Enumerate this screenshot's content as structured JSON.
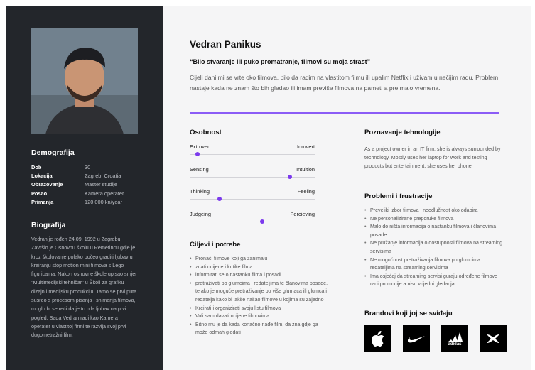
{
  "persona": {
    "name": "Vedran Panikus",
    "quote": "“Bilo stvaranje ili puko promatranje, filmovi su moja strast”",
    "intro": "Cijeli dani mi se vrte oko filmova, bilo da radim na vlastitom filmu ili upalim Netflix i uživam u nečijim radu. Problem nastaje kada ne znam što bih gledao ili imam previše filmova na pameti a pre malo vremena."
  },
  "demografija": {
    "title": "Demografija",
    "rows": [
      {
        "key": "Dob",
        "value": "30"
      },
      {
        "key": "Lokacija",
        "value": "Zagreb, Croatia"
      },
      {
        "key": "Obrazovanje",
        "value": "Master studije"
      },
      {
        "key": "Posao",
        "value": "Kamera operater"
      },
      {
        "key": "Primanja",
        "value": "120,000 kn/year"
      }
    ]
  },
  "biografija": {
    "title": "Biografija",
    "text": "Vedran je rođen 24.09. 1992 u Zagrebu. Završio je Osnovnu školu u Remetincu gdje je kroz školovanje polako počeo graditi ljubav u kreiranju stop motion mini filmova s Lego figuricama. Nakon osnovne škole upisao smjer \"Multimedijski tehničar\" u Školi za grafiku dizajn i medijsku produkciju. Tamo se prvi puta susreo s procesom pisanja i snimanja filmova, moglo bi se reći da je to bila ljubav na prvi pogled. Sada Vedran radi kao Kamera operater u vlastitoj firmi te razvija svoj prvi dugometražni film."
  },
  "osobnost": {
    "title": "Osobnost",
    "sliders": [
      {
        "left": "Extrovert",
        "right": "Inrovert",
        "value": 0.06
      },
      {
        "left": "Sensing",
        "right": "Intuition",
        "value": 0.8
      },
      {
        "left": "Thinking",
        "right": "Feeling",
        "value": 0.24
      },
      {
        "left": "Judgeing",
        "right": "Percieving",
        "value": 0.58
      }
    ]
  },
  "ciljevi": {
    "title": "Ciljevi i potrebe",
    "items": [
      "Pronaći filmove koji ga zanimaju",
      "znati ocijene i kritike filma",
      "informirati se o nastanku filma i posadi",
      "pretraživati po glumcima i redateljima te članovima posade, te ako je moguće pretraživanje po više glumaca ili glumca i redatelja kako bi lakše našao filmove u kojima su zajedno",
      "Kreirati i organizirati svoju listu filmova",
      "Voli sam davati ocijene filmovima",
      "Bitno mu je da kada konačno nađe film, da zna gdje ga može odmah gledati"
    ]
  },
  "tehnologija": {
    "title": "Poznavanje tehnologije",
    "text": "As a project owner in an IT firm, she is always surrounded by technology. Mostly uses her laptop for work and testing products but entertainment, she uses her phone."
  },
  "problemi": {
    "title": "Problemi i frustracije",
    "items": [
      "Preveliki izbor filmova i neodlučnost oko odabira",
      "Ne personalizirane preporuke filmova",
      "Malo do ništa informacija o nastanku filmova i članovima posade",
      "Ne pružanje informacija o dostupnosti filmova na streaming servisima",
      "Ne mogućnost pretraživanja filmova po glumcima i redateljima na streaming servisima",
      "Ima osjećaj da streaming servisi guraju određene filmove radi promocije a nisu vrijedni gledanja"
    ]
  },
  "brandovi": {
    "title": "Brandovi koji joj se sviđaju",
    "items": [
      {
        "icon": "apple-icon"
      },
      {
        "icon": "nike-icon"
      },
      {
        "icon": "adidas-icon",
        "text": "adidas"
      },
      {
        "icon": "under-armour-icon"
      }
    ]
  },
  "colors": {
    "accent": "#8b5cf6",
    "sidebar": "#23262b"
  }
}
